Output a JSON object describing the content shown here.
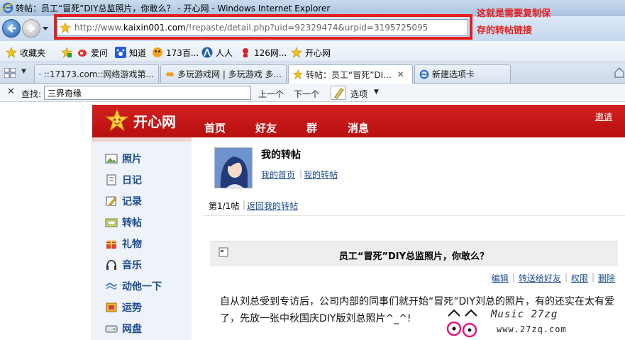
{
  "window": {
    "title": "转帖：员工“冒死”DIY总监照片，你敢么？ - 开心网 - Windows Internet Explorer"
  },
  "address": {
    "prefix": "http://www.",
    "domain": "kaixin001.com",
    "path": "/!repaste/detail.php?uid=92329474&urpid=3195725095"
  },
  "annotation": {
    "line1": "这就是需要复制保",
    "line2": "存的转帖链接",
    "color": "#e51e1e"
  },
  "favorites": {
    "items": [
      {
        "label": "收藏夹",
        "icon": "star-icon"
      },
      {
        "label": "爱问",
        "icon": "weibo-icon"
      },
      {
        "label": "知道",
        "icon": "paw-icon"
      },
      {
        "label": "173百...",
        "icon": "smiley-icon"
      },
      {
        "label": "人人",
        "icon": "renren-icon"
      },
      {
        "label": "126网...",
        "icon": "mail-icon"
      },
      {
        "label": "开心网",
        "icon": "star-icon"
      }
    ]
  },
  "tabs": [
    {
      "label": "::17173.com::网络游戏第..."
    },
    {
      "label": "多玩游戏网 | 多玩游戏 多..."
    },
    {
      "label": "转帖：员工“冒死”DI..."
    },
    {
      "label": "新建选项卡"
    }
  ],
  "find": {
    "label": "查找:",
    "value": "三界奇缘",
    "prev": "上一个",
    "next": "下一个",
    "options": "选项"
  },
  "site": {
    "logo": "开心网",
    "nav": [
      "首页",
      "好友",
      "群",
      "消息"
    ],
    "invite": "邀请",
    "brand_color": "#c8161d"
  },
  "sidebar": {
    "items": [
      {
        "label": "照片",
        "icon": "photo-icon"
      },
      {
        "label": "日记",
        "icon": "diary-icon"
      },
      {
        "label": "记录",
        "icon": "pencil-icon"
      },
      {
        "label": "转帖",
        "icon": "repost-icon"
      },
      {
        "label": "礼物",
        "icon": "gift-icon"
      },
      {
        "label": "音乐",
        "icon": "headphones-icon"
      },
      {
        "label": "动他一下",
        "icon": "poke-icon"
      },
      {
        "label": "运势",
        "icon": "fortune-icon"
      },
      {
        "label": "网盘",
        "icon": "disk-icon"
      }
    ]
  },
  "profile": {
    "title": "我的转帖",
    "link_home": "我的首页",
    "link_mine": "我的转帖"
  },
  "post": {
    "count": "第1/1帖",
    "back": "返回我的转帖",
    "title": "员工“冒死”DIY总监照片，你敢么？",
    "actions": [
      "编辑",
      "转送给好友",
      "权限",
      "删除"
    ],
    "body": "自从刘总受到专访后，公司内部的同事们就开始“冒死”DIY刘总的照片，有的还实在太有爱了，先放一张中秋国庆DIY版刘总照片^_^!"
  },
  "watermark": {
    "line1": "Music 27zg",
    "line2": "www.27zq.com"
  }
}
